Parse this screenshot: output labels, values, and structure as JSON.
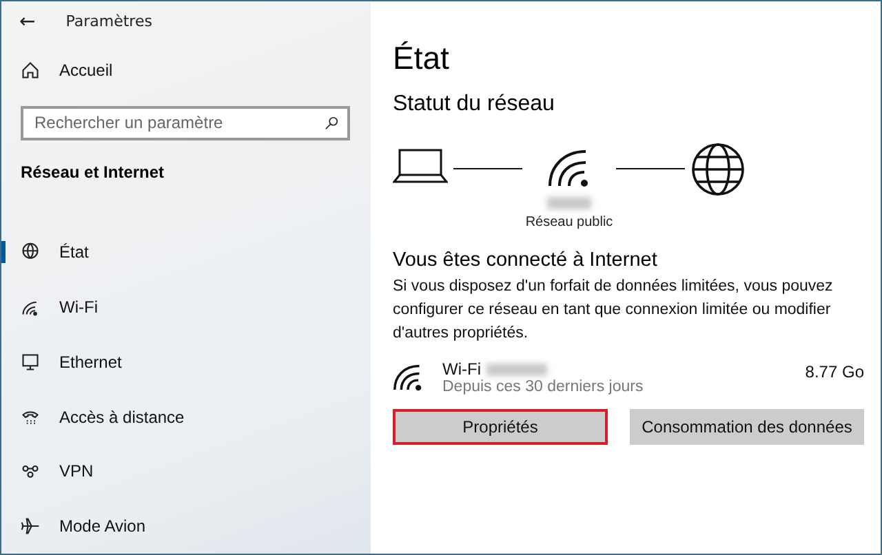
{
  "window": {
    "title": "Paramètres",
    "back": "←"
  },
  "sidebar": {
    "home": "Accueil",
    "search": {
      "placeholder": "Rechercher un paramètre"
    },
    "section": "Réseau et Internet",
    "items": [
      {
        "label": "État",
        "kind": "status",
        "selected": true
      },
      {
        "label": "Wi-Fi",
        "kind": "wifi",
        "selected": false
      },
      {
        "label": "Ethernet",
        "kind": "ethernet",
        "selected": false
      },
      {
        "label": "Accès à distance",
        "kind": "dialup",
        "selected": false
      },
      {
        "label": "VPN",
        "kind": "vpn",
        "selected": false
      },
      {
        "label": "Mode Avion",
        "kind": "airplane",
        "selected": false
      }
    ]
  },
  "main": {
    "title": "État",
    "subtitle": "Statut du réseau",
    "network_type": "Réseau public",
    "connected_title": "Vous êtes connecté à Internet",
    "description": "Si vous disposez d'un forfait de données limitées, vous pouvez configurer ce réseau en tant que connexion limitée ou modifier d'autres propriétés.",
    "connection": {
      "name": "Wi-Fi",
      "period": "Depuis ces 30 derniers jours",
      "usage": "8.77 Go"
    },
    "buttons": [
      {
        "label": "Propriétés",
        "highlighted": true
      },
      {
        "label": "Consommation des données",
        "highlighted": false
      }
    ]
  }
}
